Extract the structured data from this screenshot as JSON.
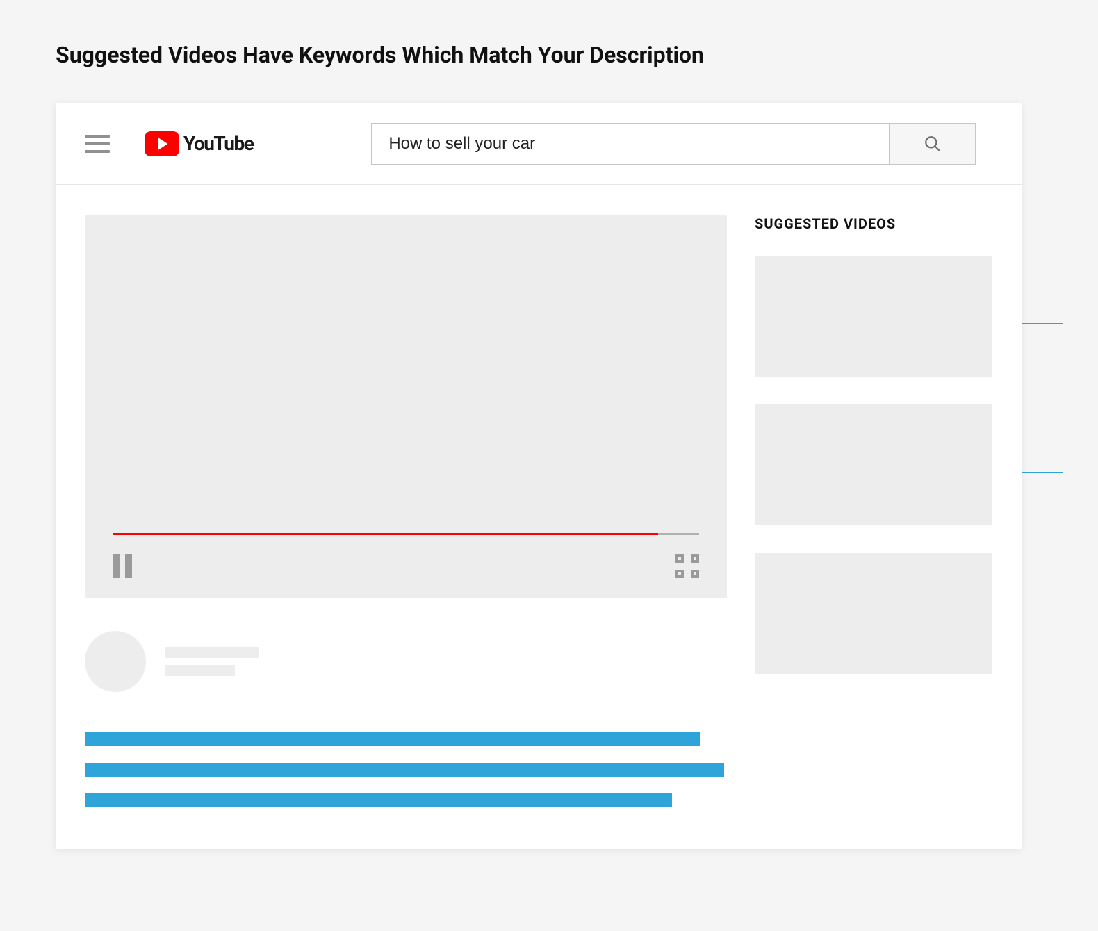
{
  "page_heading": "Suggested Videos Have Keywords Which Match Your Description",
  "header": {
    "brand": "YouTube",
    "search_value": "How to sell your car"
  },
  "sidebar": {
    "heading": "SUGGESTED VIDEOS",
    "items": [
      {
        "placeholder": true
      },
      {
        "placeholder": true
      },
      {
        "placeholder": true
      }
    ]
  }
}
